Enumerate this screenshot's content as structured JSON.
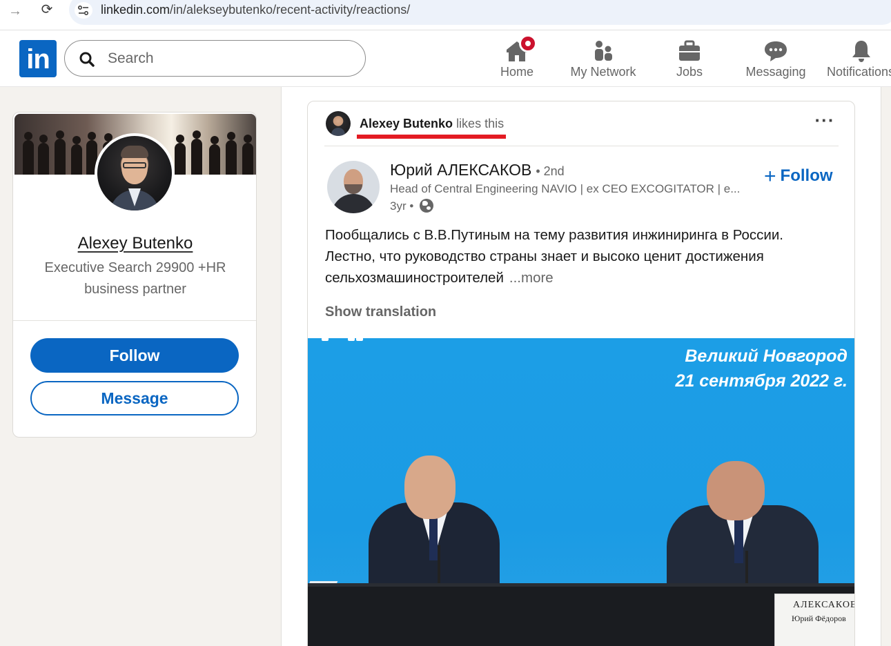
{
  "browser": {
    "url_host": "linkedin.com",
    "url_path": "/in/alekseybutenko/recent-activity/reactions/"
  },
  "header": {
    "logo": "in",
    "search_placeholder": "Search",
    "nav": [
      {
        "label": "Home",
        "icon": "home-icon",
        "has_badge": true
      },
      {
        "label": "My Network",
        "icon": "network-icon"
      },
      {
        "label": "Jobs",
        "icon": "briefcase-icon"
      },
      {
        "label": "Messaging",
        "icon": "messaging-icon"
      },
      {
        "label": "Notifications",
        "icon": "bell-icon"
      }
    ]
  },
  "profile": {
    "name": "Alexey Butenko",
    "headline": "Executive Search 29900 +HR business partner",
    "follow_label": "Follow",
    "message_label": "Message"
  },
  "post": {
    "reactor": "Alexey Butenko",
    "reaction": "likes this",
    "author": {
      "name": "Юрий АЛЕКСАКОВ",
      "degree": "• 2nd",
      "headline": "Head of Central Engineering NAVIO | ex CEO EXCOGITATOR | e...",
      "time": "3yr •"
    },
    "follow_label": "Follow",
    "body": "Пообщались с В.В.Путиным на тему развития инжиниринга в России. Лестно, что руководство страны знает и высоко ценит достижения сельхозмашиностроителей",
    "more_label": "...more",
    "translation_label": "Show translation",
    "image": {
      "caption_line1": "Великий Новгород",
      "caption_line2": "21 сентября 2022 г.",
      "nameplate_line1": "АЛЕКСАКОВ",
      "nameplate_line2": "Юрий Фёдоров"
    }
  },
  "colors": {
    "brand": "#0a66c2",
    "badge": "#cb112d",
    "highlight": "#e31b23",
    "image_background": "#1c9ee6"
  }
}
